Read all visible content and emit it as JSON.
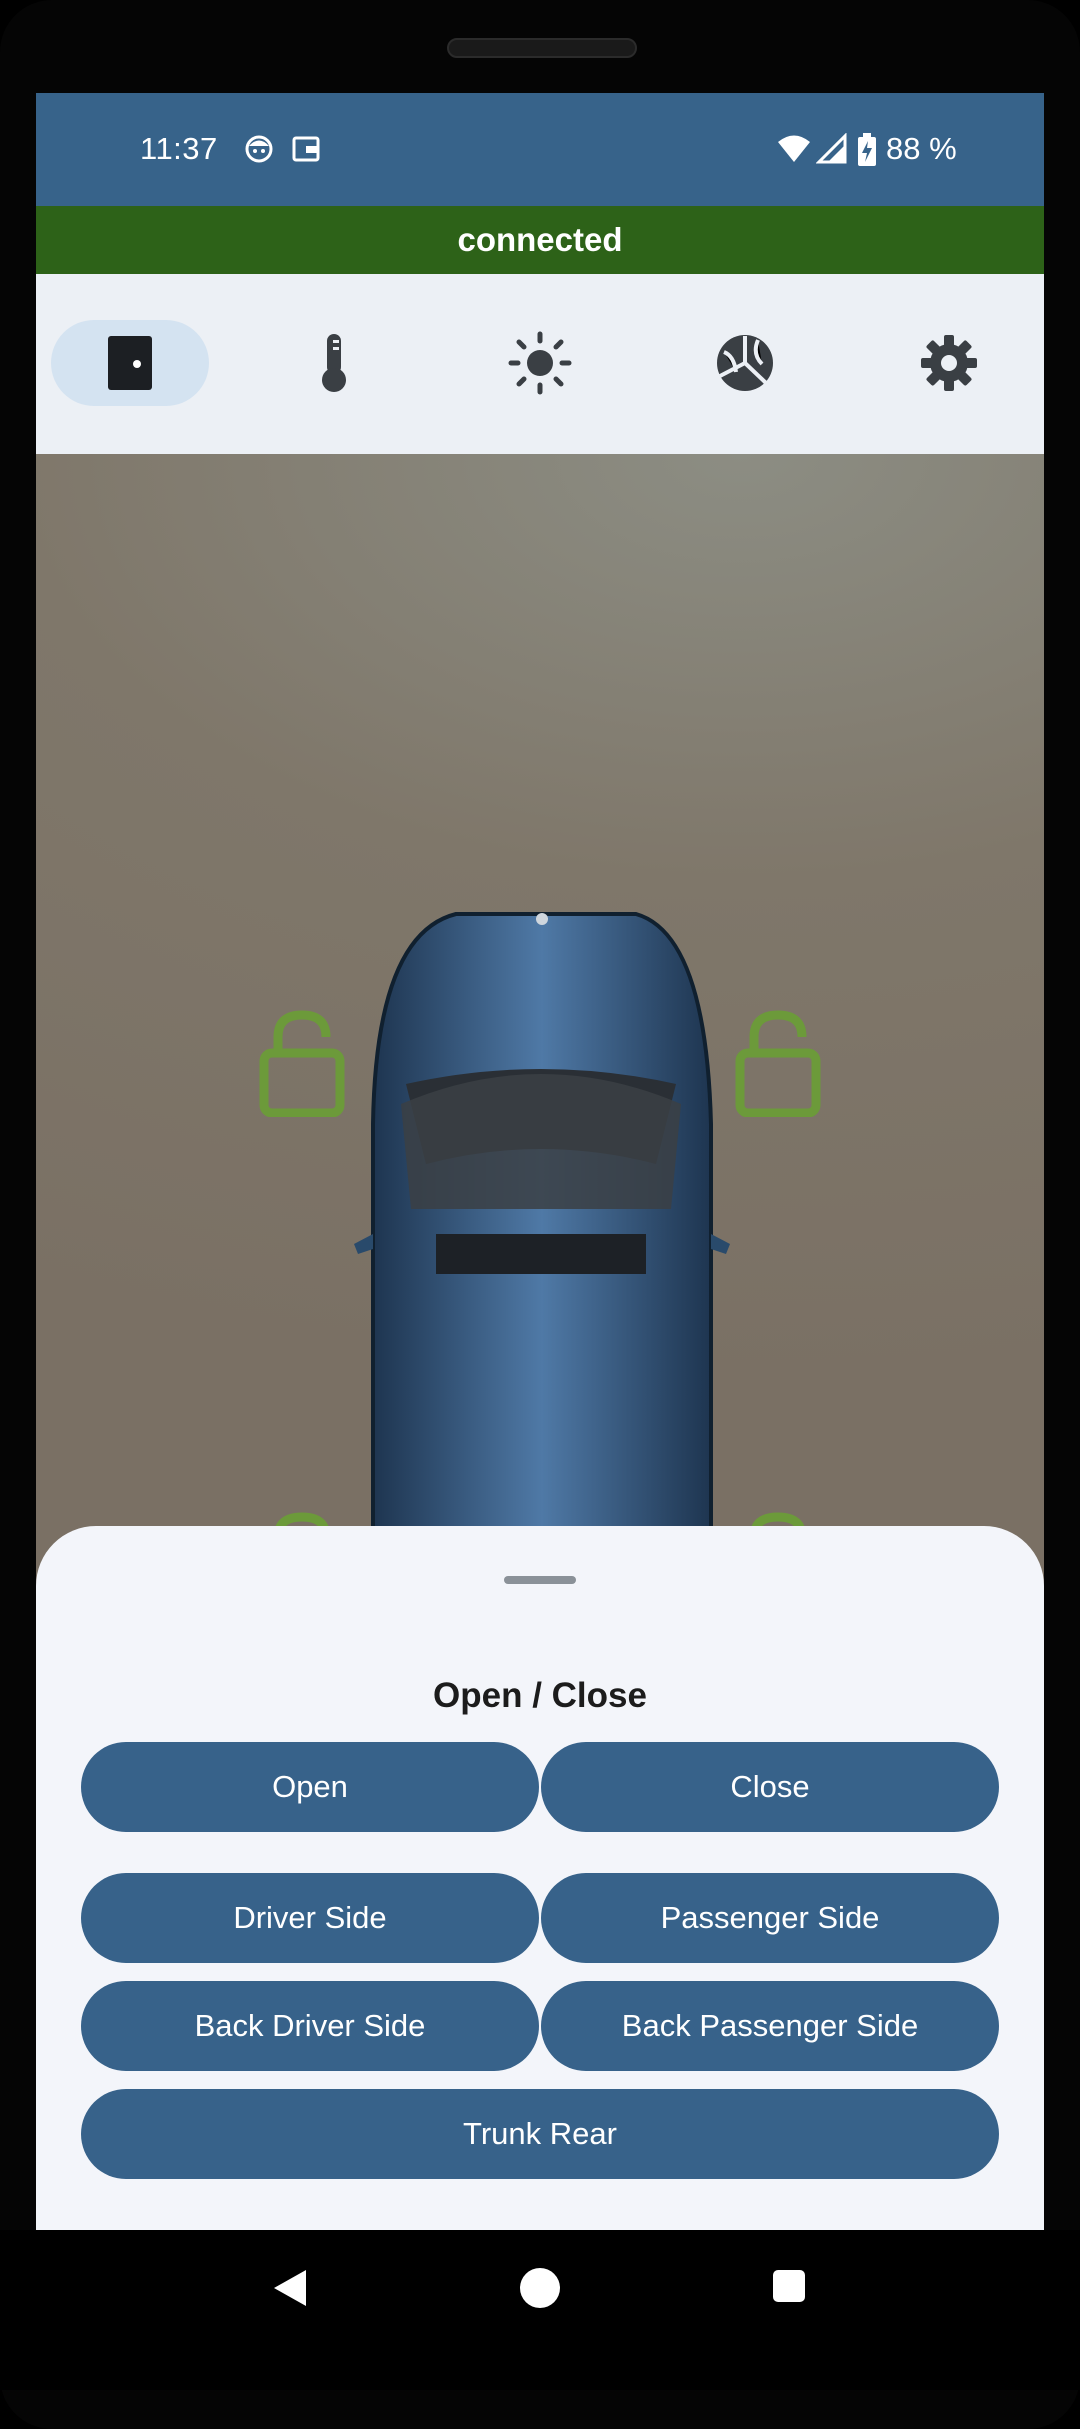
{
  "status_bar": {
    "time": "11:37",
    "battery": "88 %",
    "icons": [
      "face-icon",
      "wallet-icon",
      "wifi-icon",
      "signal-icon",
      "battery-charging-icon"
    ]
  },
  "connection": {
    "status": "connected",
    "color": "#2d6218"
  },
  "tabs": [
    {
      "icon": "door-icon",
      "active": true
    },
    {
      "icon": "thermometer-icon",
      "active": false
    },
    {
      "icon": "sun-icon",
      "active": false
    },
    {
      "icon": "wheel-icon",
      "active": false
    },
    {
      "icon": "gear-icon",
      "active": false
    }
  ],
  "car_view": {
    "lock_icons": [
      "lock-open-icon",
      "lock-open-icon",
      "lock-open-icon",
      "lock-open-icon"
    ],
    "lock_color": "#6c9a3a"
  },
  "sheet": {
    "title": "Open / Close",
    "buttons": {
      "open": "Open",
      "close": "Close",
      "driver_side": "Driver Side",
      "passenger_side": "Passenger Side",
      "back_driver_side": "Back Driver Side",
      "back_passenger_side": "Back Passenger Side",
      "trunk_rear": "Trunk Rear"
    }
  },
  "colors": {
    "primary": "#37628a",
    "status_bar": "#37638a",
    "sheet_bg": "#f3f5fa"
  }
}
